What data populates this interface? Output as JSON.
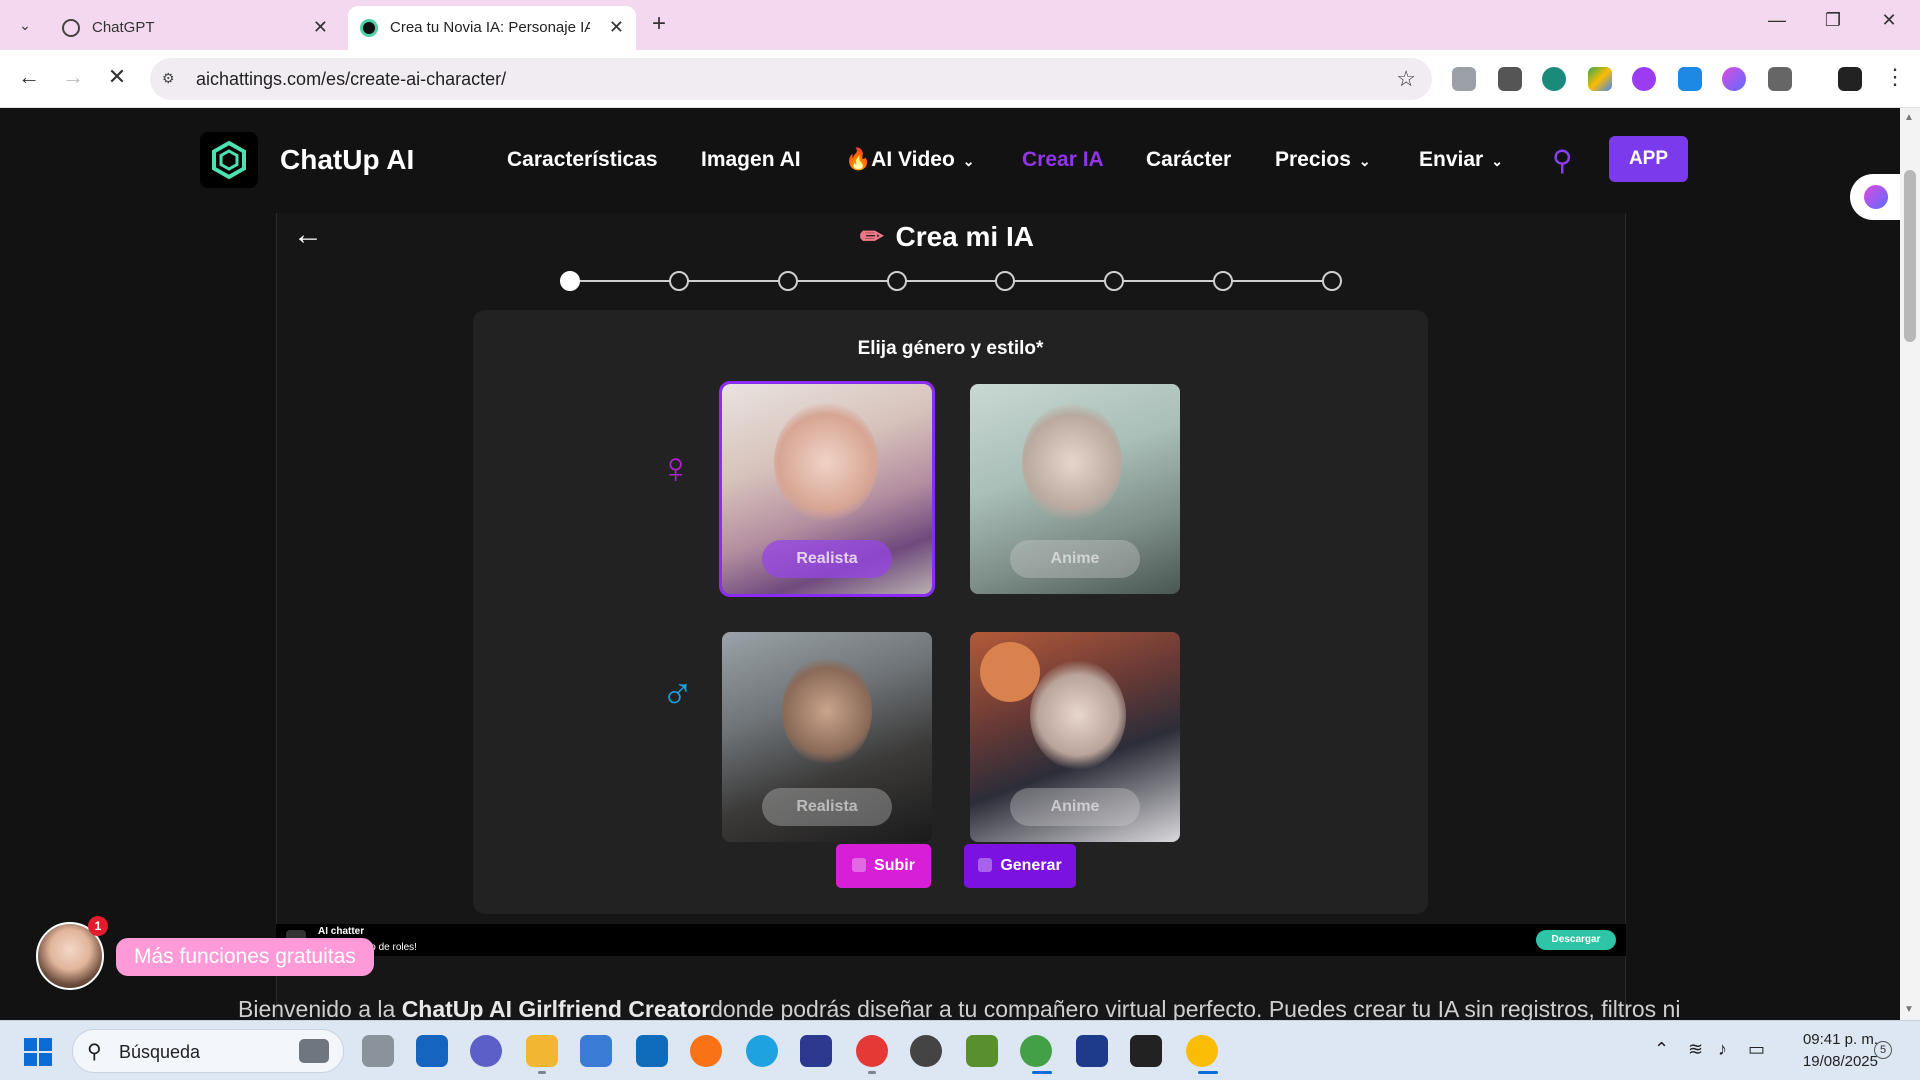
{
  "browser": {
    "tabs": [
      {
        "title": "ChatGPT",
        "active": false
      },
      {
        "title": "Crea tu Novia IA: Personaje IA S",
        "active": true
      }
    ],
    "url": "aichattings.com/es/create-ai-character/"
  },
  "site": {
    "brand": "ChatUp AI",
    "nav": {
      "features": "Características",
      "image_ai": "Imagen AI",
      "ai_video": "🔥AI Video",
      "create_ai": "Crear IA",
      "character": "Carácter",
      "pricing": "Precios",
      "send": "Enviar"
    },
    "app_button": "APP",
    "accent_color": "#7c3aed"
  },
  "creator": {
    "title": "Crea mi IA",
    "title_icon": "✏",
    "steps_total": 8,
    "current_step": 1,
    "section_title": "Elija género y estilo*",
    "female_symbol": "♀",
    "male_symbol": "♂",
    "cards": {
      "female_realistic": "Realista",
      "female_anime": "Anime",
      "male_realistic": "Realista",
      "male_anime": "Anime"
    },
    "selected_card": "female_realistic",
    "upload_button": "Subir",
    "generate_button": "Generar"
  },
  "banner": {
    "title": "AI chatter",
    "subtitle": "de IA y juego de roles!",
    "download": "Descargar"
  },
  "chat_widget": {
    "badge": "1",
    "bubble": "Más funciones gratuitas"
  },
  "intro": {
    "before": "Bienvenido a la ",
    "bold": "ChatUp AI Girlfriend Creator",
    "after": "donde podrás diseñar a tu compañero virtual perfecto. Puedes crear tu IA sin registros, filtros ni"
  },
  "taskbar": {
    "search_placeholder": "Búsqueda",
    "time": "09:41 p. m.",
    "date": "19/08/2025",
    "notifications": "5"
  }
}
